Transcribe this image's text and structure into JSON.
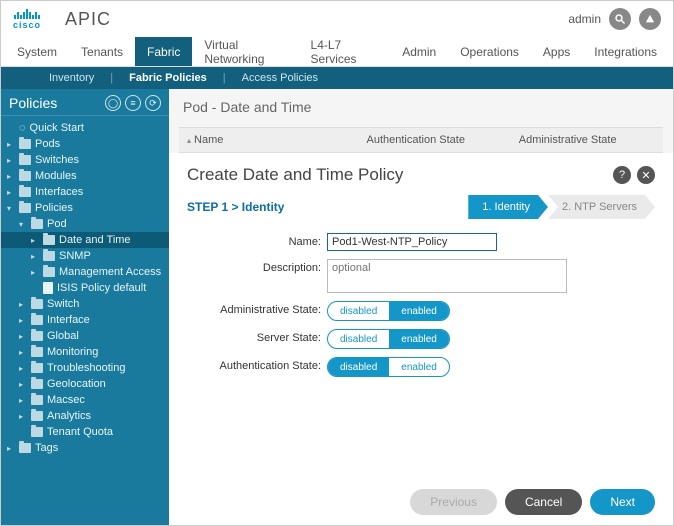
{
  "brand": {
    "logo_text": "cisco",
    "app": "APIC"
  },
  "header": {
    "user": "admin"
  },
  "main_nav": {
    "tabs": [
      "System",
      "Tenants",
      "Fabric",
      "Virtual Networking",
      "L4-L7 Services",
      "Admin",
      "Operations",
      "Apps",
      "Integrations"
    ],
    "active": 2
  },
  "sub_nav": {
    "items": [
      "Inventory",
      "Fabric Policies",
      "Access Policies"
    ],
    "active": 1
  },
  "sidebar": {
    "title": "Policies",
    "quick_start": "Quick Start",
    "items": [
      {
        "label": "Pods",
        "type": "folder"
      },
      {
        "label": "Switches",
        "type": "folder"
      },
      {
        "label": "Modules",
        "type": "folder"
      },
      {
        "label": "Interfaces",
        "type": "folder"
      },
      {
        "label": "Policies",
        "type": "folder",
        "open": true,
        "children": [
          {
            "label": "Pod",
            "type": "folder",
            "open": true,
            "children": [
              {
                "label": "Date and Time",
                "type": "folder",
                "selected": true
              },
              {
                "label": "SNMP",
                "type": "folder"
              },
              {
                "label": "Management Access",
                "type": "folder"
              },
              {
                "label": "ISIS Policy default",
                "type": "doc"
              }
            ]
          },
          {
            "label": "Switch",
            "type": "folder"
          },
          {
            "label": "Interface",
            "type": "folder"
          },
          {
            "label": "Global",
            "type": "folder"
          },
          {
            "label": "Monitoring",
            "type": "folder"
          },
          {
            "label": "Troubleshooting",
            "type": "folder"
          },
          {
            "label": "Geolocation",
            "type": "folder"
          },
          {
            "label": "Macsec",
            "type": "folder"
          },
          {
            "label": "Analytics",
            "type": "folder"
          },
          {
            "label": "Tenant Quota",
            "type": "folder"
          }
        ]
      },
      {
        "label": "Tags",
        "type": "folder"
      }
    ]
  },
  "content": {
    "title": "Pod - Date and Time",
    "columns": [
      "Name",
      "Authentication State",
      "Administrative State"
    ]
  },
  "modal": {
    "title": "Create Date and Time Policy",
    "step_heading": "STEP 1 > Identity",
    "steps": [
      {
        "num": "1.",
        "label": "Identity",
        "active": true
      },
      {
        "num": "2.",
        "label": "NTP Servers",
        "active": false
      }
    ],
    "fields": {
      "name": {
        "label": "Name:",
        "value": "Pod1-West-NTP_Policy"
      },
      "description": {
        "label": "Description:",
        "placeholder": "optional"
      },
      "admin_state": {
        "label": "Administrative State:",
        "options": [
          "disabled",
          "enabled"
        ],
        "selected": 1
      },
      "server_state": {
        "label": "Server State:",
        "options": [
          "disabled",
          "enabled"
        ],
        "selected": 1
      },
      "auth_state": {
        "label": "Authentication State:",
        "options": [
          "disabled",
          "enabled"
        ],
        "selected": 0
      }
    },
    "buttons": {
      "previous": "Previous",
      "cancel": "Cancel",
      "next": "Next"
    }
  }
}
